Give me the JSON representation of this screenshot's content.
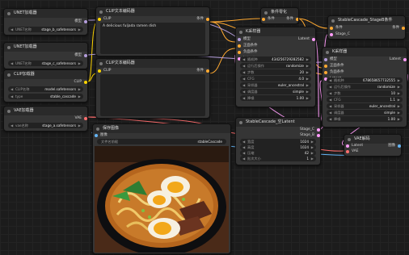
{
  "nodes": {
    "unet1": {
      "title": "UNET加载器",
      "out": "模型",
      "w_label": "UNET名称",
      "w_value": "stage_b_safetensors"
    },
    "unet2": {
      "title": "UNET加载器",
      "out": "模型",
      "w_label": "UNET名称",
      "w_value": "stage_c_safetensors"
    },
    "clip_loader": {
      "title": "CLIP加载器",
      "out": "CLIP",
      "w1_label": "CLIP名称",
      "w1_value": "model.safetensors",
      "w2_label": "type",
      "w2_value": "stable_cascade"
    },
    "vae_loader": {
      "title": "VAE加载器",
      "out": "VAE",
      "w_label": "vae名称",
      "w_value": "stage_a.safetensors"
    },
    "clip_pos": {
      "title": "CLIP文本编码器",
      "in": "CLIP",
      "out": "条件",
      "text": "A delicious fuljada ramen dish"
    },
    "clip_neg": {
      "title": "CLIP文本编码器",
      "in": "CLIP",
      "out": "条件",
      "text": ""
    },
    "cond_zero": {
      "title": "条件零化",
      "in": "条件",
      "out": "条件"
    },
    "ksampler1": {
      "title": "K采样器",
      "inputs": [
        "模型",
        "正面条件",
        "负面条件",
        "Latent"
      ],
      "out": "Latent",
      "widgets": [
        {
          "label": "随机种",
          "value": "434256729282582"
        },
        {
          "label": "运行后操作",
          "value": "randomize"
        },
        {
          "label": "步数",
          "value": "20"
        },
        {
          "label": "CFG",
          "value": "4.0"
        },
        {
          "label": "采样器",
          "value": "euler_ancestral"
        },
        {
          "label": "调度器",
          "value": "simple"
        },
        {
          "label": "降噪",
          "value": "1.00"
        }
      ]
    },
    "sc_stageb": {
      "title": "StableCascade_StageB条件",
      "inputs": [
        "条件",
        "Stage_C"
      ],
      "out": "条件"
    },
    "ksampler2": {
      "title": "K采样器",
      "inputs": [
        "模型",
        "正面条件",
        "负面条件",
        "Latent"
      ],
      "out": "Latent",
      "widgets": [
        {
          "label": "随机种",
          "value": "678658657732555"
        },
        {
          "label": "运行后操作",
          "value": "randomize"
        },
        {
          "label": "步数",
          "value": "10"
        },
        {
          "label": "CFG",
          "value": "1.1"
        },
        {
          "label": "采样器",
          "value": "euler_ancestral"
        },
        {
          "label": "调度器",
          "value": "simple"
        },
        {
          "label": "降噪",
          "value": "1.00"
        }
      ]
    },
    "sc_latent": {
      "title": "StableCascade_空Latent",
      "outputs": [
        "Stage_C",
        "Stage_B"
      ],
      "widgets": [
        {
          "label": "宽度",
          "value": "1024"
        },
        {
          "label": "高度",
          "value": "1024"
        },
        {
          "label": "压缩",
          "value": "42"
        },
        {
          "label": "批次大小",
          "value": "1"
        }
      ]
    },
    "vae_decode": {
      "title": "VAE解码",
      "inputs": [
        "Latent",
        "VAE"
      ],
      "out": "图像"
    },
    "save_image": {
      "title": "保存图像",
      "in": "图像",
      "w_label": "文件名前缀",
      "w_value": "stableCascade"
    }
  },
  "colors": {
    "canvas": "#1c1c1c",
    "node": "#353535",
    "header": "#2a2a2a",
    "port_model": "#b39ddb",
    "port_clip": "#ffd500",
    "port_cond": "#ffa931",
    "port_latent": "#ff9cf9",
    "port_vae": "#ff6e6e",
    "port_image": "#64b5f6"
  }
}
